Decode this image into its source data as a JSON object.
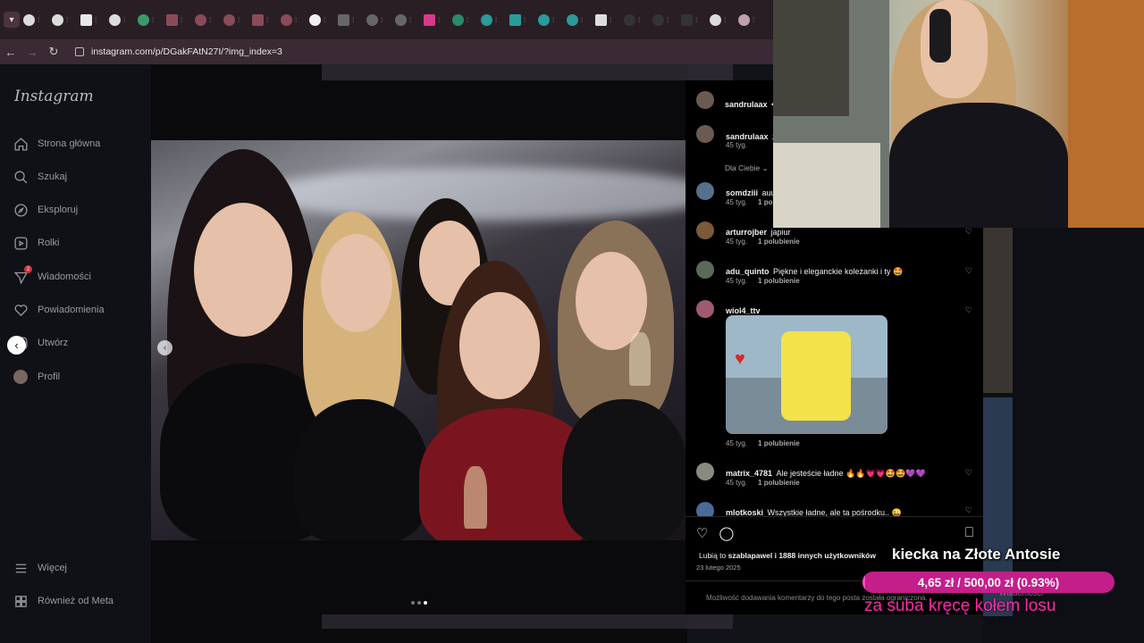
{
  "browser": {
    "url": "instagram.com/p/DGakFAtN27I/?img_index=3",
    "tab_favicons": [
      "G",
      "G",
      "L",
      "G",
      "P",
      "Y",
      "Y",
      "Y",
      "Y",
      "Y",
      "L",
      "D",
      "D",
      "D",
      "IG",
      "W",
      "V",
      "V",
      "V",
      "V",
      "G",
      "SM",
      "SM",
      "SM",
      "G",
      "X"
    ]
  },
  "sidebar": {
    "logo": "Instagram",
    "items": [
      {
        "label": "Strona główna",
        "icon": "home-icon"
      },
      {
        "label": "Szukaj",
        "icon": "search-icon"
      },
      {
        "label": "Eksploruj",
        "icon": "compass-icon"
      },
      {
        "label": "Rolki",
        "icon": "reels-icon"
      },
      {
        "label": "Wiadomości",
        "icon": "messenger-icon",
        "badge": "2"
      },
      {
        "label": "Powiadomienia",
        "icon": "heart-icon"
      },
      {
        "label": "Utwórz",
        "icon": "plus-icon"
      },
      {
        "label": "Profil",
        "icon": "avatar-icon"
      }
    ],
    "more": "Więcej",
    "meta": "Również od Meta"
  },
  "post": {
    "author": "sandrulaax",
    "author_dot": "•",
    "caption_author": "sandrulaax",
    "caption_partial": "z",
    "caption_time": "45 tyg.",
    "for_you": "Dla Ciebie",
    "comments": [
      {
        "user": "somdziii",
        "text": "auu",
        "time": "45 tyg.",
        "likes": "1 polubi"
      },
      {
        "user": "arturrojber",
        "text": "japiur",
        "time": "45 tyg.",
        "likes": "1 polubienie"
      },
      {
        "user": "adu_quinto",
        "text": "Piękne i eleganckie koleżanki i ty 🤩",
        "time": "45 tyg.",
        "likes": "1 polubienie"
      },
      {
        "user": "wiol4_ttv",
        "text": "",
        "time": "45 tyg.",
        "likes": "1 polubienie",
        "gif": "spongebob-gif"
      },
      {
        "user": "matrix_4781",
        "text": "Ale jesteście ładne 🔥🔥💗💗🤩🤩💜💜",
        "time": "45 tyg.",
        "likes": "1 polubienie"
      },
      {
        "user": "mlotkoski",
        "text": "Wszystkie ładne, ale ta pośrodku.. 😜",
        "time": "",
        "likes": ""
      }
    ],
    "liked_by_prefix": "Lubią to",
    "liked_by_user": "szablapawel",
    "liked_by_suffix": "i 1888 innych użytkowników",
    "date": "23 lutego 2025",
    "restricted": "Możliwość dodawania komentarzy do tego posta została ograniczona.",
    "carousel_index": 3,
    "carousel_total": 3
  },
  "overlay": {
    "goal_title": "kiecka na Złote Antosie",
    "goal_text": "4,65 zł / 500,00 zł (0.93%)",
    "goal_fraction": 0.0093,
    "subtitle": "za suba kręcę kołem losu",
    "ghost_text": "Wiadomości"
  },
  "colors": {
    "goal_bar": "#c41e8a",
    "subtitle": "#ff2aa8",
    "tabstrip": "#2a1e25"
  }
}
